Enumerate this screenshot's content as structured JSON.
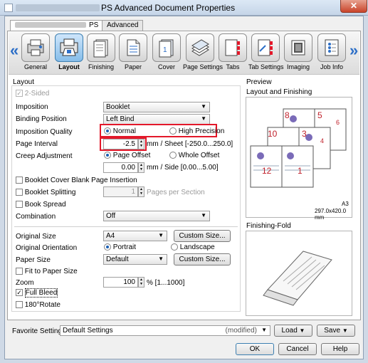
{
  "window": {
    "title": "PS Advanced Document Properties",
    "close_glyph": "✕"
  },
  "tabs": [
    {
      "label": "PS"
    },
    {
      "label": "Advanced"
    }
  ],
  "categories": [
    {
      "label": "General",
      "icon": "general-icon"
    },
    {
      "label": "Layout",
      "icon": "layout-icon"
    },
    {
      "label": "Finishing",
      "icon": "finishing-icon"
    },
    {
      "label": "Paper",
      "icon": "paper-icon"
    },
    {
      "label": "Cover",
      "icon": "cover-icon"
    },
    {
      "label": "Page Settings",
      "icon": "page-settings-icon"
    },
    {
      "label": "Tabs",
      "icon": "tabs-icon"
    },
    {
      "label": "Tab Settings",
      "icon": "tab-settings-icon"
    },
    {
      "label": "Imaging",
      "icon": "imaging-icon"
    },
    {
      "label": "Job Info",
      "icon": "job-info-icon"
    }
  ],
  "nav": {
    "prev": "«",
    "next": "»"
  },
  "layout": {
    "group_title": "Layout",
    "two_sided": "2-Sided",
    "imposition_label": "Imposition",
    "imposition_value": "Booklet",
    "binding_label": "Binding Position",
    "binding_value": "Left Bind",
    "quality_label": "Imposition Quality",
    "quality_normal": "Normal",
    "quality_high": "High Precision",
    "interval_label": "Page Interval",
    "interval_value": "-2.5",
    "interval_unit": "mm / Sheet [-250.0...250.0]",
    "creep_label": "Creep Adjustment",
    "creep_page_offset": "Page Offset",
    "creep_whole_offset": "Whole Offset",
    "creep_value": "0.00",
    "creep_unit": "mm / Side [0.00...5.00]",
    "cover_blank": "Booklet Cover Blank Page Insertion",
    "splitting": "Booklet Splitting",
    "splitting_value": "1",
    "splitting_unit": "Pages per Section",
    "book_spread": "Book Spread",
    "combination_label": "Combination",
    "combination_value": "Off",
    "original_size_label": "Original Size",
    "original_size_value": "A4",
    "custom_size_1": "Custom Size...",
    "orientation_label": "Original Orientation",
    "orientation_portrait": "Portrait",
    "orientation_landscape": "Landscape",
    "paper_size_label": "Paper Size",
    "paper_size_value": "Default",
    "custom_size_2": "Custom Size...",
    "fit_paper": "Fit to Paper Size",
    "zoom_label": "Zoom",
    "zoom_value": "100",
    "zoom_unit": "% [1...1000]",
    "full_bleed": "Full Bleed",
    "rotate": "180°Rotate",
    "checkmark": "✓"
  },
  "preview": {
    "title": "Preview",
    "layout_finishing": "Layout and Finishing",
    "page_numbers": [
      "8",
      "5",
      "6",
      "10",
      "3",
      "4",
      "12",
      "1"
    ],
    "paper": "A3",
    "paper_dims": "297.0x420.0 mm",
    "finishing_fold": "Finishing-Fold"
  },
  "favorite": {
    "label": "Favorite Setting",
    "value": "Default Settings",
    "modified": "(modified)",
    "load": "Load",
    "save": "Save"
  },
  "buttons": {
    "ok": "OK",
    "cancel": "Cancel",
    "help": "Help"
  },
  "colors": {
    "accent": "#2d6fc7",
    "highlight": "#e3182a",
    "page_number": "#c0202a"
  }
}
